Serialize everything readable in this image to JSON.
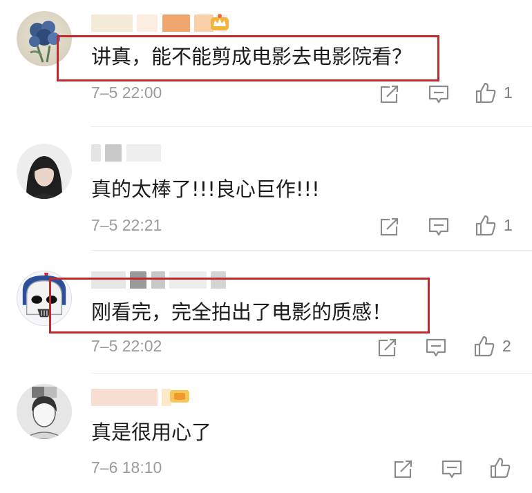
{
  "comments": [
    {
      "text": "讲真，能不能剪成电影去电影院看？",
      "time": "7–5 22:00",
      "likes": "1",
      "avatar_icon": "blue-rose-illustration-avatar",
      "badge_icon": "vip-crown-icon"
    },
    {
      "text": "真的太棒了!!!良心巨作!!!",
      "time": "7–5 22:21",
      "likes": "1",
      "avatar_icon": "girl-portrait-avatar"
    },
    {
      "text": "刚看完，完全拍出了电影的质感！",
      "time": "7–5 22:02",
      "likes": "2",
      "avatar_icon": "stormtrooper-avatar"
    },
    {
      "text": "真是很用心了",
      "time": "7–6 18:10",
      "likes": "",
      "avatar_icon": "sketch-portrait-avatar",
      "badge_icon": "vip-badge-icon"
    }
  ],
  "colors": {
    "highlight": "#c0282b",
    "username": "#e8a13f",
    "icon": "#8a8a8a"
  }
}
